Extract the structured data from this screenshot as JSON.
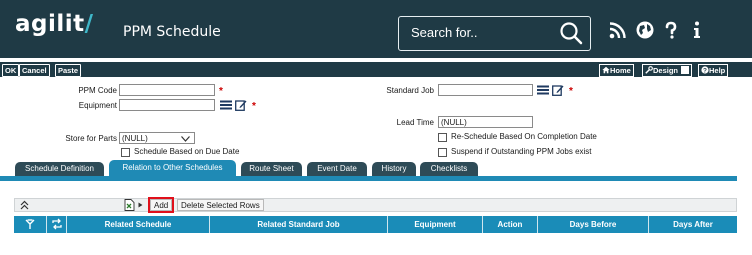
{
  "header": {
    "logo_text": "agilit",
    "logo_slash": "/",
    "title": "PPM Schedule",
    "search_placeholder": "Search for..",
    "icons": [
      "rss-icon",
      "globe-icon",
      "help-icon",
      "info-icon"
    ]
  },
  "toolbar": {
    "left": [
      "OK",
      "Cancel",
      "Paste"
    ],
    "home": "Home",
    "design": "Design",
    "help": "Help"
  },
  "form": {
    "ppm_code_label": "PPM Code",
    "ppm_code_value": "",
    "equipment_label": "Equipment",
    "equipment_value": "",
    "standard_job_label": "Standard Job",
    "standard_job_value": "",
    "lead_time_label": "Lead Time",
    "lead_time_value": "(NULL)",
    "store_label": "Store for Parts",
    "store_value": "(NULL)",
    "reschedule_label": "Re-Schedule Based On Completion Date",
    "due_date_label": "Schedule Based on Due Date",
    "suspend_label": "Suspend if Outstanding PPM Jobs exist"
  },
  "tabs": [
    {
      "label": "Schedule Definition",
      "active": false
    },
    {
      "label": "Relation to Other Schedules",
      "active": true
    },
    {
      "label": "Route Sheet",
      "active": false
    },
    {
      "label": "Event Date",
      "active": false
    },
    {
      "label": "History",
      "active": false
    },
    {
      "label": "Checklists",
      "active": false
    }
  ],
  "grid": {
    "add_label": "Add",
    "delete_label": "Delete Selected Rows",
    "columns": [
      "Related Schedule",
      "Related Standard Job",
      "Equipment",
      "Action",
      "Days Before",
      "Days After"
    ]
  },
  "colors": {
    "header_bg": "#1f3a45",
    "accent": "#1f8ab5",
    "required": "#cc0000",
    "highlight": "#e0101b"
  }
}
